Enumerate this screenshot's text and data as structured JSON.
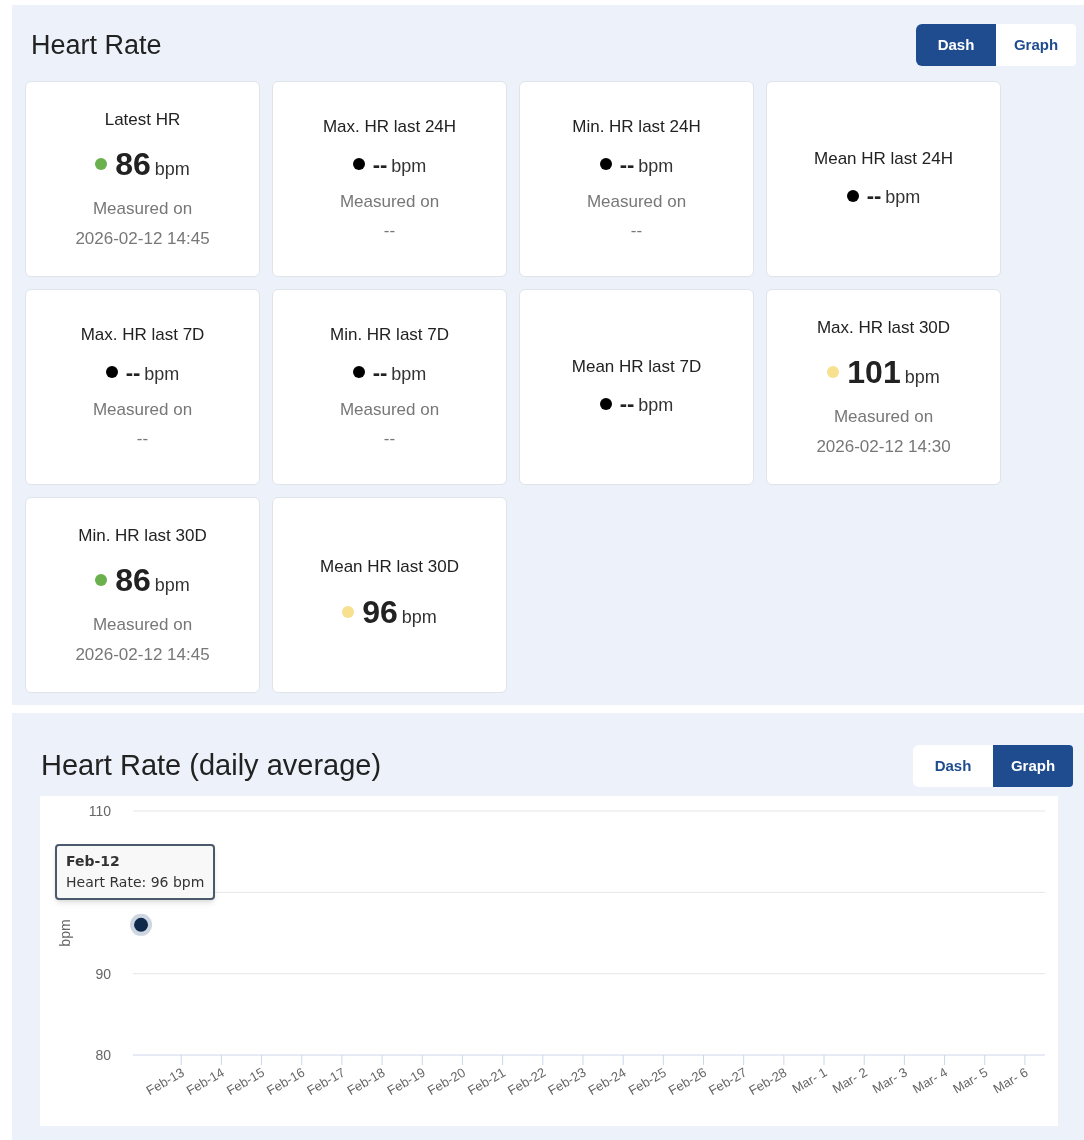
{
  "dashboard": {
    "title": "Heart Rate",
    "toggle": [
      {
        "label": "Dash",
        "selected": true
      },
      {
        "label": "Graph",
        "selected": false
      }
    ],
    "cards": [
      {
        "title": "Latest HR",
        "color": "#6ab04c",
        "value": "86",
        "unit": "bpm",
        "measured_label": "Measured on",
        "measured_at": "2026-02-12 14:45"
      },
      {
        "title": "Max. HR last 24H",
        "color": "#000000",
        "value": "--",
        "unit": "bpm",
        "measured_label": "Measured on",
        "measured_at": "--"
      },
      {
        "title": "Min. HR last 24H",
        "color": "#000000",
        "value": "--",
        "unit": "bpm",
        "measured_label": "Measured on",
        "measured_at": "--"
      },
      {
        "title": "Mean HR last 24H",
        "color": "#000000",
        "value": "--",
        "unit": "bpm"
      },
      {
        "title": "Max. HR last 7D",
        "color": "#000000",
        "value": "--",
        "unit": "bpm",
        "measured_label": "Measured on",
        "measured_at": "--"
      },
      {
        "title": "Min. HR last 7D",
        "color": "#000000",
        "value": "--",
        "unit": "bpm",
        "measured_label": "Measured on",
        "measured_at": "--"
      },
      {
        "title": "Mean HR last 7D",
        "color": "#000000",
        "value": "--",
        "unit": "bpm"
      },
      {
        "title": "Max. HR last 30D",
        "color": "#f7e08e",
        "value": "101",
        "unit": "bpm",
        "measured_label": "Measured on",
        "measured_at": "2026-02-12 14:30"
      },
      {
        "title": "Min. HR last 30D",
        "color": "#6ab04c",
        "value": "86",
        "unit": "bpm",
        "measured_label": "Measured on",
        "measured_at": "2026-02-12 14:45"
      },
      {
        "title": "Mean HR last 30D",
        "color": "#f7e08e",
        "value": "96",
        "unit": "bpm"
      }
    ]
  },
  "graph": {
    "title": "Heart Rate (daily average)",
    "toggle": [
      {
        "label": "Dash",
        "selected": false
      },
      {
        "label": "Graph",
        "selected": true
      }
    ],
    "tooltip": {
      "title": "Feb-12",
      "separator": ":",
      "value": "96 bpm"
    },
    "chart_data": {
      "type": "line",
      "ylabel": "bpm",
      "categories": [
        null,
        "Feb-13",
        "Feb-14",
        "Feb-15",
        "Feb-16",
        "Feb-17",
        "Feb-18",
        "Feb-19",
        "Feb-20",
        "Feb-21",
        "Feb-22",
        "Feb-23",
        "Feb-24",
        "Feb-25",
        "Feb-26",
        "Feb-27",
        "Feb-28",
        "Mar- 1",
        "Mar- 2",
        "Mar- 3",
        "Mar- 4",
        "Mar- 5",
        "Mar- 6"
      ],
      "series": [
        {
          "name": "Heart Rate",
          "color": "#0f2a4a",
          "marker": true,
          "values": [
            96,
            null,
            null,
            null,
            null,
            null,
            null,
            null,
            null,
            null,
            null,
            null,
            null,
            null,
            null,
            null,
            null,
            null,
            null,
            null,
            null,
            null,
            null
          ]
        }
      ],
      "ylim": [
        80,
        110
      ],
      "yticks": [
        80,
        90,
        110
      ]
    }
  }
}
